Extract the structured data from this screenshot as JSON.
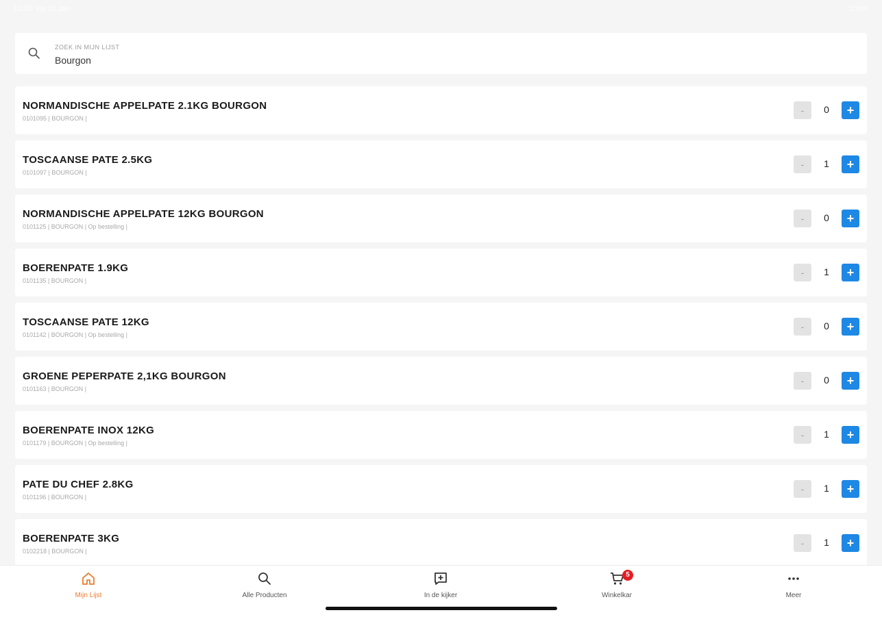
{
  "status_bar": {
    "left": "12:00 Vrij 10 Jan",
    "right": "100%"
  },
  "search": {
    "label": "ZOEK IN MIJN LIJST",
    "value": "Bourgon"
  },
  "products": [
    {
      "name": "NORMANDISCHE APPELPATE 2.1KG BOURGON",
      "meta": "0101095 | BOURGON |",
      "qty": "0"
    },
    {
      "name": "TOSCAANSE PATE 2.5KG",
      "meta": "0101097 | BOURGON |",
      "qty": "1"
    },
    {
      "name": "NORMANDISCHE APPELPATE 12KG BOURGON",
      "meta": "0101125 | BOURGON | Op bestelling |",
      "qty": "0"
    },
    {
      "name": "BOERENPATE 1.9KG",
      "meta": "0101135 | BOURGON |",
      "qty": "1"
    },
    {
      "name": "TOSCAANSE PATE 12KG",
      "meta": "0101142 | BOURGON | Op bestelling |",
      "qty": "0"
    },
    {
      "name": "GROENE PEPERPATE 2,1KG BOURGON",
      "meta": "0101163 | BOURGON |",
      "qty": "0"
    },
    {
      "name": "BOERENPATE INOX 12KG",
      "meta": "0101179 | BOURGON | Op bestelling |",
      "qty": "1"
    },
    {
      "name": "PATE DU CHEF 2.8KG",
      "meta": "0101196 | BOURGON |",
      "qty": "1"
    },
    {
      "name": "BOERENPATE 3KG",
      "meta": "0102218 | BOURGON |",
      "qty": "1"
    }
  ],
  "controls": {
    "minus": "-",
    "plus": "+"
  },
  "tabs": [
    {
      "label": "Mijn Lijst",
      "icon": "home-icon"
    },
    {
      "label": "Alle Producten",
      "icon": "search-icon"
    },
    {
      "label": "In de kijker",
      "icon": "spotlight-icon"
    },
    {
      "label": "Winkelkar",
      "icon": "cart-icon",
      "badge": "5"
    },
    {
      "label": "Meer",
      "icon": "more-icon"
    }
  ],
  "colors": {
    "accent": "#ec7a2d",
    "primary_button": "#1e88e5",
    "badge": "#e51c23"
  }
}
